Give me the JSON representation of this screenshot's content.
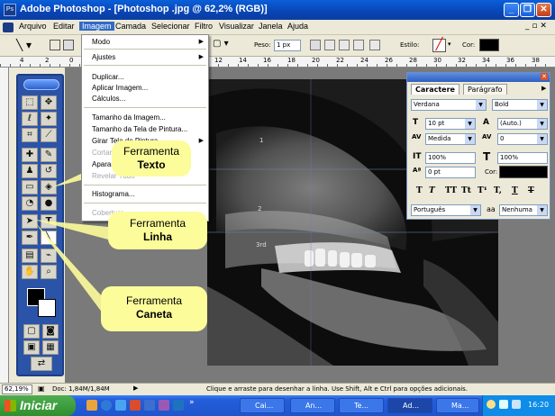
{
  "titlebar": {
    "title": "Adobe Photoshop - [Photoshop .jpg @ 62,2% (RGB)]",
    "logo": "Ps"
  },
  "menubar": {
    "items": [
      "Arquivo",
      "Editar",
      "Imagem",
      "Camada",
      "Selecionar",
      "Filtro",
      "Visualizar",
      "Janela",
      "Ajuda"
    ]
  },
  "options": {
    "weight_label": "Peso:",
    "weight_value": "1 px",
    "style_label": "Estilo:",
    "color_label": "Cor:"
  },
  "ruler": {
    "numbers": [
      "4",
      "2",
      "0",
      "12",
      "14",
      "16",
      "18",
      "20",
      "22",
      "24",
      "26",
      "28",
      "30",
      "32",
      "34",
      "36",
      "38"
    ]
  },
  "image_menu": {
    "items": [
      {
        "label": "Modo",
        "submenu": true,
        "disabled": false
      },
      {
        "label": "Ajustes",
        "submenu": true,
        "disabled": false
      },
      {
        "label": "Duplicar...",
        "submenu": false,
        "disabled": false
      },
      {
        "label": "Aplicar Imagem...",
        "submenu": false,
        "disabled": false
      },
      {
        "label": "Cálculos...",
        "submenu": false,
        "disabled": false
      },
      {
        "label": "Tamanho da Imagem...",
        "submenu": false,
        "disabled": false
      },
      {
        "label": "Tamanho da Tela de Pintura...",
        "submenu": false,
        "disabled": false
      },
      {
        "label": "Girar Tela de Pintura",
        "submenu": true,
        "disabled": false
      },
      {
        "label": "Cortar",
        "submenu": false,
        "disabled": true
      },
      {
        "label": "Aparar...",
        "submenu": false,
        "disabled": false
      },
      {
        "label": "Revelar Tudo",
        "submenu": false,
        "disabled": true
      },
      {
        "label": "Histograma...",
        "submenu": false,
        "disabled": false
      },
      {
        "label": "Cobertura...",
        "submenu": false,
        "disabled": true
      }
    ]
  },
  "callouts": {
    "texto": {
      "line1": "Ferramenta",
      "line2": "Texto"
    },
    "linha": {
      "line1": "Ferramenta",
      "line2": "Linha"
    },
    "caneta": {
      "line1": "Ferramenta",
      "line2": "Caneta"
    }
  },
  "character_panel": {
    "tabs": [
      "Caractere",
      "Parágrafo"
    ],
    "font": "Verdana",
    "style": "Bold",
    "size": "10 pt",
    "leading": "(Auto.)",
    "kerning": "Medida",
    "tracking": "0",
    "vscale": "100%",
    "hscale": "100%",
    "baseline": "0 pt",
    "color_label": "Cor:",
    "format_buttons": [
      "T",
      "T",
      "TT",
      "Tt",
      "T¹",
      "T,",
      "T",
      "T"
    ],
    "language": "Português",
    "antialias": "Nenhuma",
    "aa_icon": "aa"
  },
  "xray_labels": [
    "3rd",
    "1",
    "2"
  ],
  "statusbar": {
    "zoom": "62,19%",
    "doc": "Doc: 1,84M/1,84M",
    "hint": "Clique e arraste para desenhar a linha. Use Shift, Alt e Ctrl para opções adicionais."
  },
  "taskbar": {
    "start": "Iniciar",
    "tasks": [
      "Cai...",
      "An...",
      "Te...",
      "Ad...",
      "Ma..."
    ],
    "active_task": "Ad...",
    "clock": "16:20"
  },
  "colors": {
    "accent": "#316ac5",
    "toolbox": "#2b53a8",
    "callout": "#fdfc9a"
  }
}
